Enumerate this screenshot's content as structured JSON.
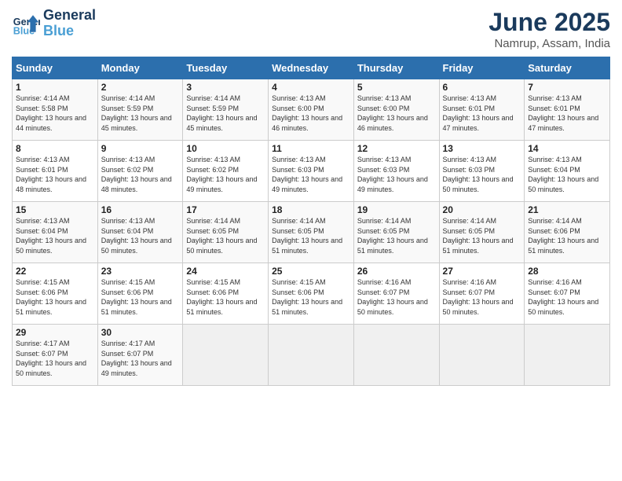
{
  "header": {
    "logo_line1": "General",
    "logo_line2": "Blue",
    "title": "June 2025",
    "subtitle": "Namrup, Assam, India"
  },
  "days_of_week": [
    "Sunday",
    "Monday",
    "Tuesday",
    "Wednesday",
    "Thursday",
    "Friday",
    "Saturday"
  ],
  "weeks": [
    [
      {
        "day": "1",
        "sunrise": "4:14 AM",
        "sunset": "5:58 PM",
        "daylight": "13 hours and 44 minutes."
      },
      {
        "day": "2",
        "sunrise": "4:14 AM",
        "sunset": "5:59 PM",
        "daylight": "13 hours and 45 minutes."
      },
      {
        "day": "3",
        "sunrise": "4:14 AM",
        "sunset": "5:59 PM",
        "daylight": "13 hours and 45 minutes."
      },
      {
        "day": "4",
        "sunrise": "4:13 AM",
        "sunset": "6:00 PM",
        "daylight": "13 hours and 46 minutes."
      },
      {
        "day": "5",
        "sunrise": "4:13 AM",
        "sunset": "6:00 PM",
        "daylight": "13 hours and 46 minutes."
      },
      {
        "day": "6",
        "sunrise": "4:13 AM",
        "sunset": "6:01 PM",
        "daylight": "13 hours and 47 minutes."
      },
      {
        "day": "7",
        "sunrise": "4:13 AM",
        "sunset": "6:01 PM",
        "daylight": "13 hours and 47 minutes."
      }
    ],
    [
      {
        "day": "8",
        "sunrise": "4:13 AM",
        "sunset": "6:01 PM",
        "daylight": "13 hours and 48 minutes."
      },
      {
        "day": "9",
        "sunrise": "4:13 AM",
        "sunset": "6:02 PM",
        "daylight": "13 hours and 48 minutes."
      },
      {
        "day": "10",
        "sunrise": "4:13 AM",
        "sunset": "6:02 PM",
        "daylight": "13 hours and 49 minutes."
      },
      {
        "day": "11",
        "sunrise": "4:13 AM",
        "sunset": "6:03 PM",
        "daylight": "13 hours and 49 minutes."
      },
      {
        "day": "12",
        "sunrise": "4:13 AM",
        "sunset": "6:03 PM",
        "daylight": "13 hours and 49 minutes."
      },
      {
        "day": "13",
        "sunrise": "4:13 AM",
        "sunset": "6:03 PM",
        "daylight": "13 hours and 50 minutes."
      },
      {
        "day": "14",
        "sunrise": "4:13 AM",
        "sunset": "6:04 PM",
        "daylight": "13 hours and 50 minutes."
      }
    ],
    [
      {
        "day": "15",
        "sunrise": "4:13 AM",
        "sunset": "6:04 PM",
        "daylight": "13 hours and 50 minutes."
      },
      {
        "day": "16",
        "sunrise": "4:13 AM",
        "sunset": "6:04 PM",
        "daylight": "13 hours and 50 minutes."
      },
      {
        "day": "17",
        "sunrise": "4:14 AM",
        "sunset": "6:05 PM",
        "daylight": "13 hours and 50 minutes."
      },
      {
        "day": "18",
        "sunrise": "4:14 AM",
        "sunset": "6:05 PM",
        "daylight": "13 hours and 51 minutes."
      },
      {
        "day": "19",
        "sunrise": "4:14 AM",
        "sunset": "6:05 PM",
        "daylight": "13 hours and 51 minutes."
      },
      {
        "day": "20",
        "sunrise": "4:14 AM",
        "sunset": "6:05 PM",
        "daylight": "13 hours and 51 minutes."
      },
      {
        "day": "21",
        "sunrise": "4:14 AM",
        "sunset": "6:06 PM",
        "daylight": "13 hours and 51 minutes."
      }
    ],
    [
      {
        "day": "22",
        "sunrise": "4:15 AM",
        "sunset": "6:06 PM",
        "daylight": "13 hours and 51 minutes."
      },
      {
        "day": "23",
        "sunrise": "4:15 AM",
        "sunset": "6:06 PM",
        "daylight": "13 hours and 51 minutes."
      },
      {
        "day": "24",
        "sunrise": "4:15 AM",
        "sunset": "6:06 PM",
        "daylight": "13 hours and 51 minutes."
      },
      {
        "day": "25",
        "sunrise": "4:15 AM",
        "sunset": "6:06 PM",
        "daylight": "13 hours and 51 minutes."
      },
      {
        "day": "26",
        "sunrise": "4:16 AM",
        "sunset": "6:07 PM",
        "daylight": "13 hours and 50 minutes."
      },
      {
        "day": "27",
        "sunrise": "4:16 AM",
        "sunset": "6:07 PM",
        "daylight": "13 hours and 50 minutes."
      },
      {
        "day": "28",
        "sunrise": "4:16 AM",
        "sunset": "6:07 PM",
        "daylight": "13 hours and 50 minutes."
      }
    ],
    [
      {
        "day": "29",
        "sunrise": "4:17 AM",
        "sunset": "6:07 PM",
        "daylight": "13 hours and 50 minutes."
      },
      {
        "day": "30",
        "sunrise": "4:17 AM",
        "sunset": "6:07 PM",
        "daylight": "13 hours and 49 minutes."
      },
      null,
      null,
      null,
      null,
      null
    ]
  ]
}
